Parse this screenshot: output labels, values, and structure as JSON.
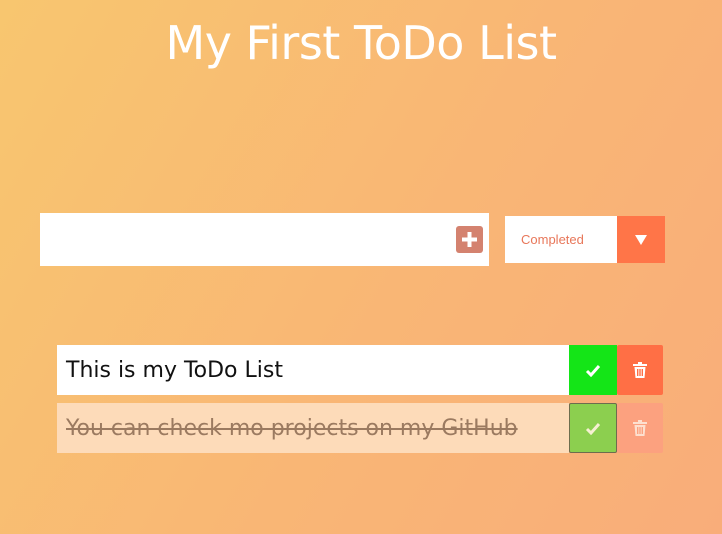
{
  "header": {
    "title": "My First ToDo List"
  },
  "form": {
    "input_value": "",
    "input_placeholder": "",
    "add_icon": "plus-icon"
  },
  "filter": {
    "selected": "Completed",
    "arrow_icon": "caret-down-icon"
  },
  "todos": [
    {
      "text": "This is my ToDo List",
      "completed": false
    },
    {
      "text": "You can check mo projects on my GitHub",
      "completed": true
    }
  ],
  "colors": {
    "check": "#14e517",
    "check_completed": "#8ccf4f",
    "trash": "#ff6f45",
    "filter_accent": "#ff7548"
  }
}
